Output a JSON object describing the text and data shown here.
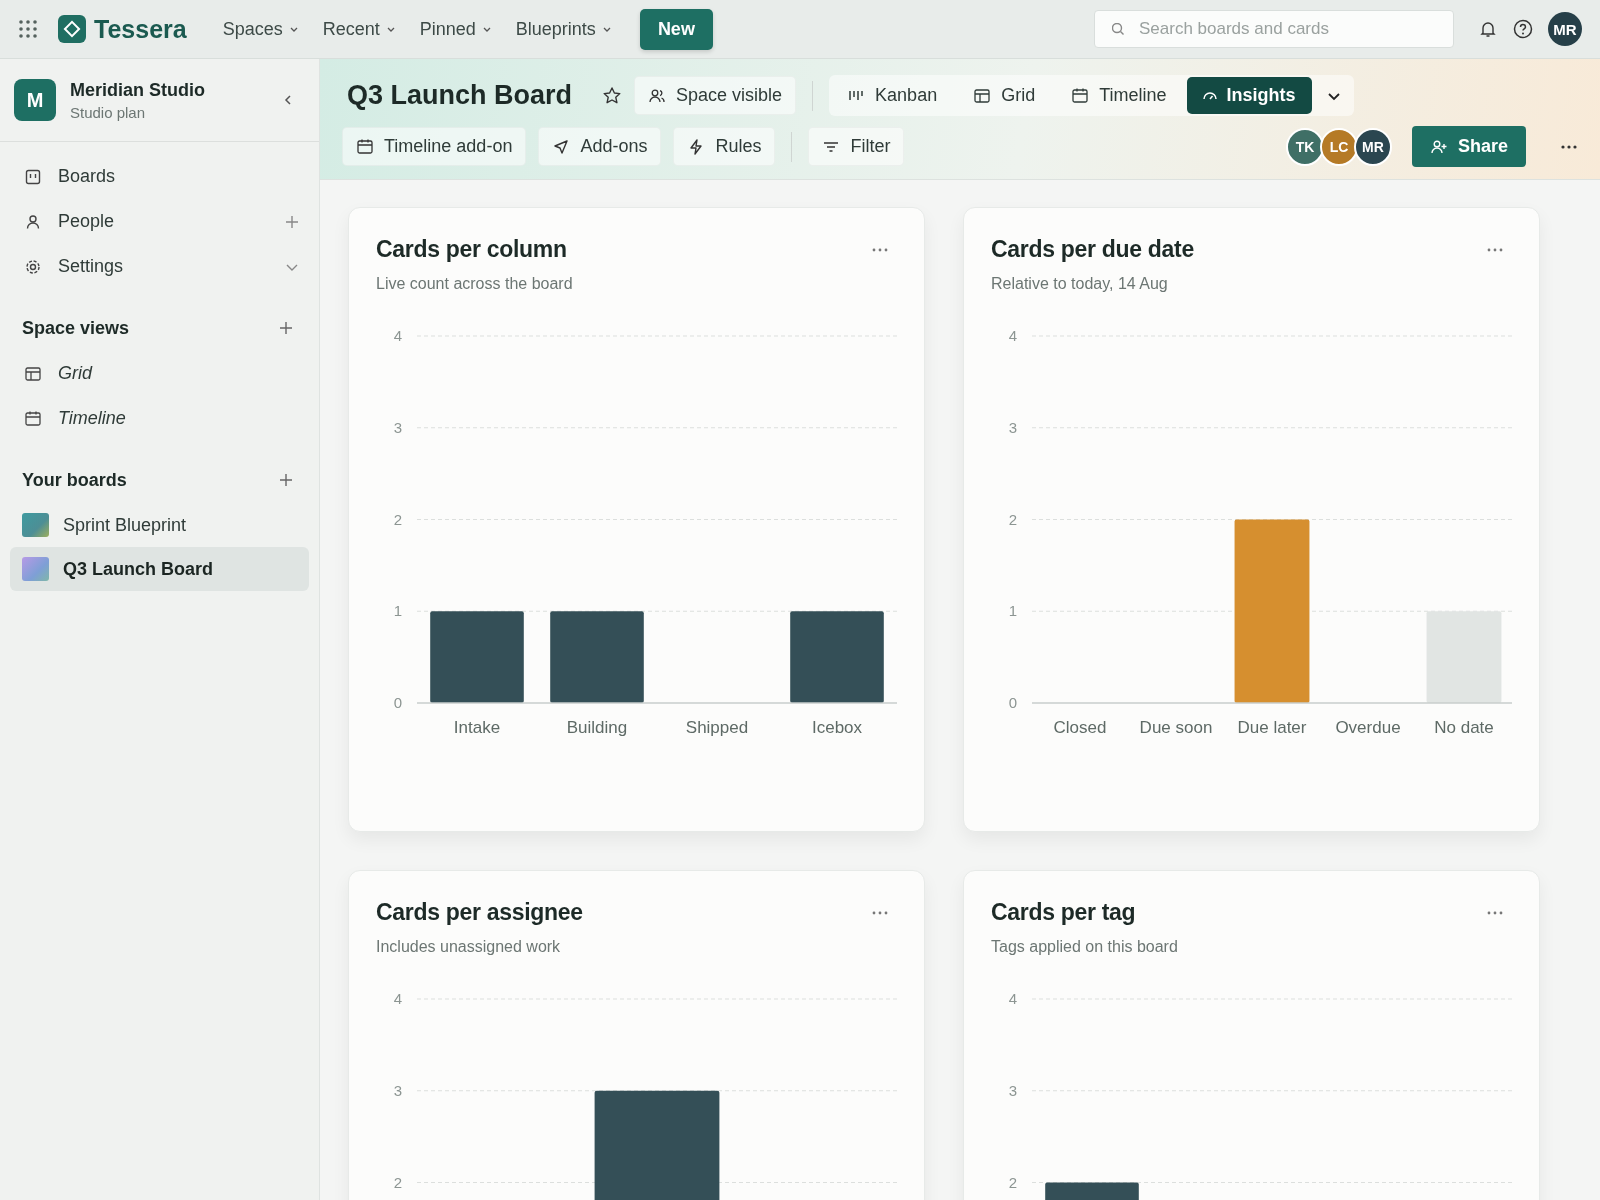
{
  "topbar": {
    "logo": "Tessera",
    "menus": [
      {
        "label": "Spaces"
      },
      {
        "label": "Recent"
      },
      {
        "label": "Pinned"
      },
      {
        "label": "Blueprints"
      }
    ],
    "new_button": "New",
    "search": {
      "placeholder": "Search boards and cards"
    },
    "avatar": "MR"
  },
  "sidebar": {
    "workspace": {
      "initial": "M",
      "name": "Meridian Studio",
      "plan": "Studio plan"
    },
    "nav": [
      {
        "label": "Boards",
        "kind": "boards"
      },
      {
        "label": "People",
        "kind": "people"
      },
      {
        "label": "Settings",
        "kind": "settings"
      }
    ],
    "space_views": {
      "title": "Space views",
      "items": [
        {
          "label": "Grid",
          "kind": "grid"
        },
        {
          "label": "Timeline",
          "kind": "timeline"
        }
      ]
    },
    "boards": {
      "title": "Your boards",
      "items": [
        {
          "label": "Sprint Blueprint",
          "selected": false
        },
        {
          "label": "Q3 Launch Board",
          "selected": true
        }
      ]
    }
  },
  "header": {
    "title": "Q3 Launch Board",
    "visibility": "Space visible",
    "views": [
      {
        "label": "Kanban",
        "kind": "kanban",
        "selected": false
      },
      {
        "label": "Grid",
        "kind": "grid",
        "selected": false
      },
      {
        "label": "Timeline",
        "kind": "timeline",
        "selected": false
      },
      {
        "label": "Insights",
        "kind": "insights",
        "selected": true
      }
    ],
    "tools": [
      {
        "label": "Timeline add-on",
        "kind": "calendar"
      },
      {
        "label": "Add-ons",
        "kind": "send"
      },
      {
        "label": "Rules",
        "kind": "bolt"
      },
      {
        "label": "Filter",
        "kind": "filter"
      }
    ],
    "members": [
      {
        "initials": "TK",
        "color": "#3f6f66"
      },
      {
        "initials": "LC",
        "color": "#b57a26"
      },
      {
        "initials": "MR",
        "color": "#2b4650"
      }
    ],
    "share": "Share"
  },
  "cards": [
    {
      "title": "Cards per column",
      "subtitle": "Live count across the board",
      "chart_data": {
        "type": "bar",
        "categories": [
          "Intake",
          "Building",
          "Shipped",
          "Icebox"
        ],
        "values": [
          1,
          1,
          0,
          1
        ],
        "colors": [
          "#344f57",
          "#344f57",
          null,
          "#344f57"
        ],
        "grid": true,
        "ylim": [
          0,
          4
        ],
        "yticks": [
          0,
          1,
          2,
          3,
          4
        ]
      }
    },
    {
      "title": "Cards per due date",
      "subtitle": "Relative to today, 14 Aug",
      "chart_data": {
        "type": "bar",
        "categories": [
          "Closed",
          "Due soon",
          "Due later",
          "Overdue",
          "No date"
        ],
        "values": [
          0,
          0,
          2,
          0,
          1
        ],
        "colors": [
          null,
          null,
          "#d68f2f",
          null,
          "#e1e5e3"
        ],
        "grid": true,
        "ylim": [
          0,
          4
        ],
        "yticks": [
          0,
          1,
          2,
          3,
          4
        ]
      }
    },
    {
      "title": "Cards per assignee",
      "subtitle": "Includes unassigned work",
      "chart_data": {
        "type": "bar",
        "values": [
          null,
          3,
          null
        ],
        "colors": [
          null,
          "#344f57",
          null
        ],
        "grid": true,
        "ylim": [
          0,
          4
        ],
        "yticks": [
          2,
          3,
          4
        ]
      }
    },
    {
      "title": "Cards per tag",
      "subtitle": "Tags applied on this board",
      "chart_data": {
        "type": "bar",
        "values": [
          2,
          null,
          null,
          null
        ],
        "colors": [
          "#344f57",
          null,
          null,
          null
        ],
        "grid": true,
        "ylim": [
          0,
          4
        ],
        "yticks": [
          2,
          3,
          4
        ]
      }
    }
  ]
}
